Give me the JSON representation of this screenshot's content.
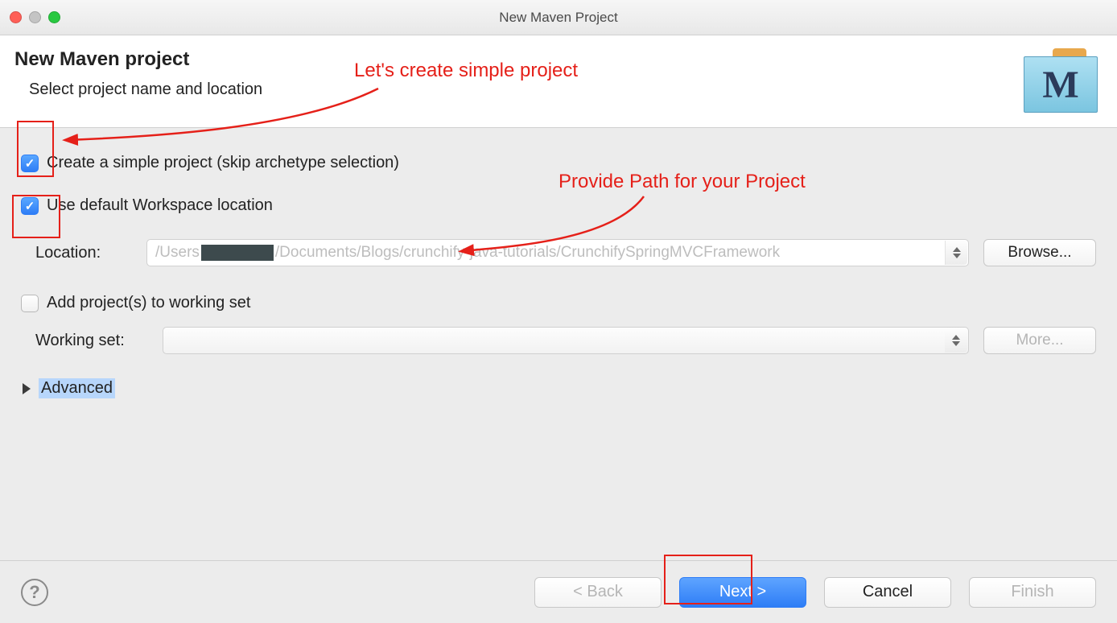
{
  "window": {
    "title": "New Maven Project"
  },
  "wizard": {
    "title": "New Maven project",
    "subtitle": "Select project name and location"
  },
  "checkboxes": {
    "simple_project": "Create a simple project (skip archetype selection)",
    "use_default_ws": "Use default Workspace location",
    "add_to_workingset": "Add project(s) to working set"
  },
  "location": {
    "label": "Location:",
    "path_prefix": "/Users",
    "path_suffix": "/Documents/Blogs/crunchify-java-tutorials/CrunchifySpringMVCFramework",
    "browse": "Browse..."
  },
  "workingset": {
    "label": "Working set:",
    "more": "More..."
  },
  "advanced": {
    "label": "Advanced"
  },
  "footer": {
    "back": "< Back",
    "next": "Next >",
    "cancel": "Cancel",
    "finish": "Finish"
  },
  "annotations": {
    "create_simple": "Let's create simple project",
    "provide_path": "Provide Path for your Project"
  }
}
